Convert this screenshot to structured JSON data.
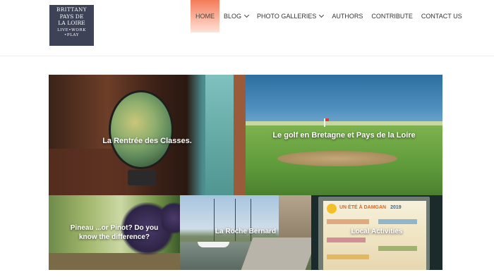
{
  "logo": {
    "line1": "BRITTANY",
    "line2": "PAYS DE",
    "line3": "LA LOIRE",
    "line4": "LIVE•WORK",
    "line5": "•PLAY"
  },
  "nav": {
    "items": [
      {
        "label": "HOME",
        "active": true,
        "has_dropdown": false
      },
      {
        "label": "BLOG",
        "active": false,
        "has_dropdown": true
      },
      {
        "label": "PHOTO GALLERIES",
        "active": false,
        "has_dropdown": true
      },
      {
        "label": "AUTHORS",
        "active": false,
        "has_dropdown": false
      },
      {
        "label": "CONTRIBUTE",
        "active": false,
        "has_dropdown": false
      },
      {
        "label": "CONTACT US",
        "active": false,
        "has_dropdown": false
      }
    ],
    "active_color": "#f47c5a"
  },
  "tiles": [
    {
      "caption": "La Rentrée des Classes."
    },
    {
      "caption": "Le golf en Bretagne et Pays de la Loire"
    },
    {
      "caption": "Pineau ...or Pinot? Do you know the difference?"
    },
    {
      "caption": "La Roche Bernard"
    },
    {
      "caption": "Local Activities"
    }
  ],
  "poster": {
    "title": "UN ÉTÉ À DAMGAN",
    "year": "2019"
  },
  "colors": {
    "logo_bg": "#3d4256"
  }
}
